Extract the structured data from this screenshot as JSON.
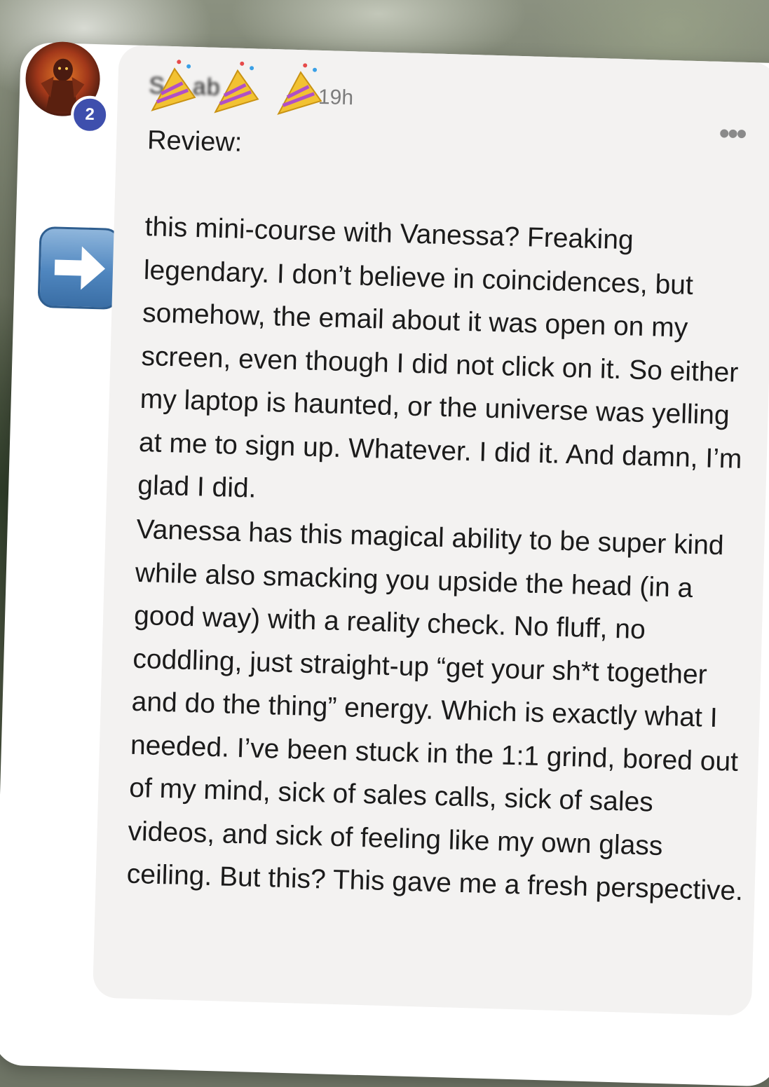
{
  "post": {
    "author_name": "S   s  ab",
    "time": "19h",
    "comment_count_badge": "2",
    "review_label": "Review:",
    "paragraph_1": "this mini-course with Vanessa? Freaking legendary. I don’t believe in coincidences, but somehow, the email about it was open on my screen, even though I did not click on it. So either my laptop is haunted, or the universe was yelling at me to sign up. Whatever. I did it. And damn, I’m glad I did.",
    "paragraph_2": "Vanessa has this magical ability to be super kind while also smacking you upside the head (in a good way) with a reality check. No fluff, no coddling, just straight-up “get your sh*t together and do the thing” energy. Which is exactly what I needed. I’ve been stuck in the 1:1 grind, bored out of my mind, sick of sales calls, sick of sales videos, and sick of feeling like my own glass ceiling. But this? This gave me a fresh perspective.",
    "more_icon": "more-options-icon",
    "emoji_icons": [
      "party-popper-icon",
      "party-popper-icon",
      "party-popper-icon"
    ],
    "arrow_emoji": "right-arrow-icon"
  },
  "colors": {
    "badge": "#3e4fad",
    "bubble": "#f3f2f1",
    "text": "#1b1b1b",
    "arrow_blue": "#4f86bf"
  }
}
